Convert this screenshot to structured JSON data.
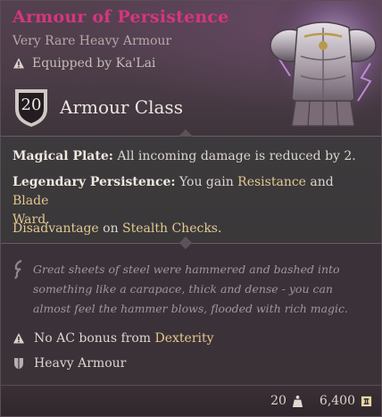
{
  "item": {
    "name": "Armour of Persistence",
    "rarity_type": "Very Rare Heavy Armour",
    "equipped_by": "Equipped by Ka'Lai",
    "armour_class_value": "20",
    "armour_class_label": "Armour Class"
  },
  "properties": {
    "magical_plate": {
      "name": "Magical Plate:",
      "text": " All incoming damage is reduced by 2."
    },
    "legendary_persistence": {
      "name": "Legendary Persistence:",
      "text1": " You gain ",
      "resistance": "Resistance",
      "text2": " and ",
      "blade_ward_1": "Blade",
      "blade_ward_2": "Ward",
      "text3": "."
    },
    "stealth": {
      "disadvantage": "Disadvantage",
      "text": " on ",
      "stealth_checks": "Stealth Checks",
      "end": "."
    }
  },
  "flavor_text": "Great sheets of steel were hammered and bashed into something like a carapace, thick and dense - you can almost feel the hammer blows, flooded with rich magic.",
  "notes": {
    "dex_prefix": "No AC bonus from ",
    "dex_word": "Dexterity",
    "category": "Heavy Armour"
  },
  "footer": {
    "weight": "20",
    "value": "6,400"
  },
  "colors": {
    "title": "#d6357f",
    "keyword": "#e3c890"
  },
  "icons": [
    "warning-icon",
    "shield-icon",
    "quill-icon",
    "armour-category-icon",
    "weight-icon",
    "gold-icon"
  ]
}
